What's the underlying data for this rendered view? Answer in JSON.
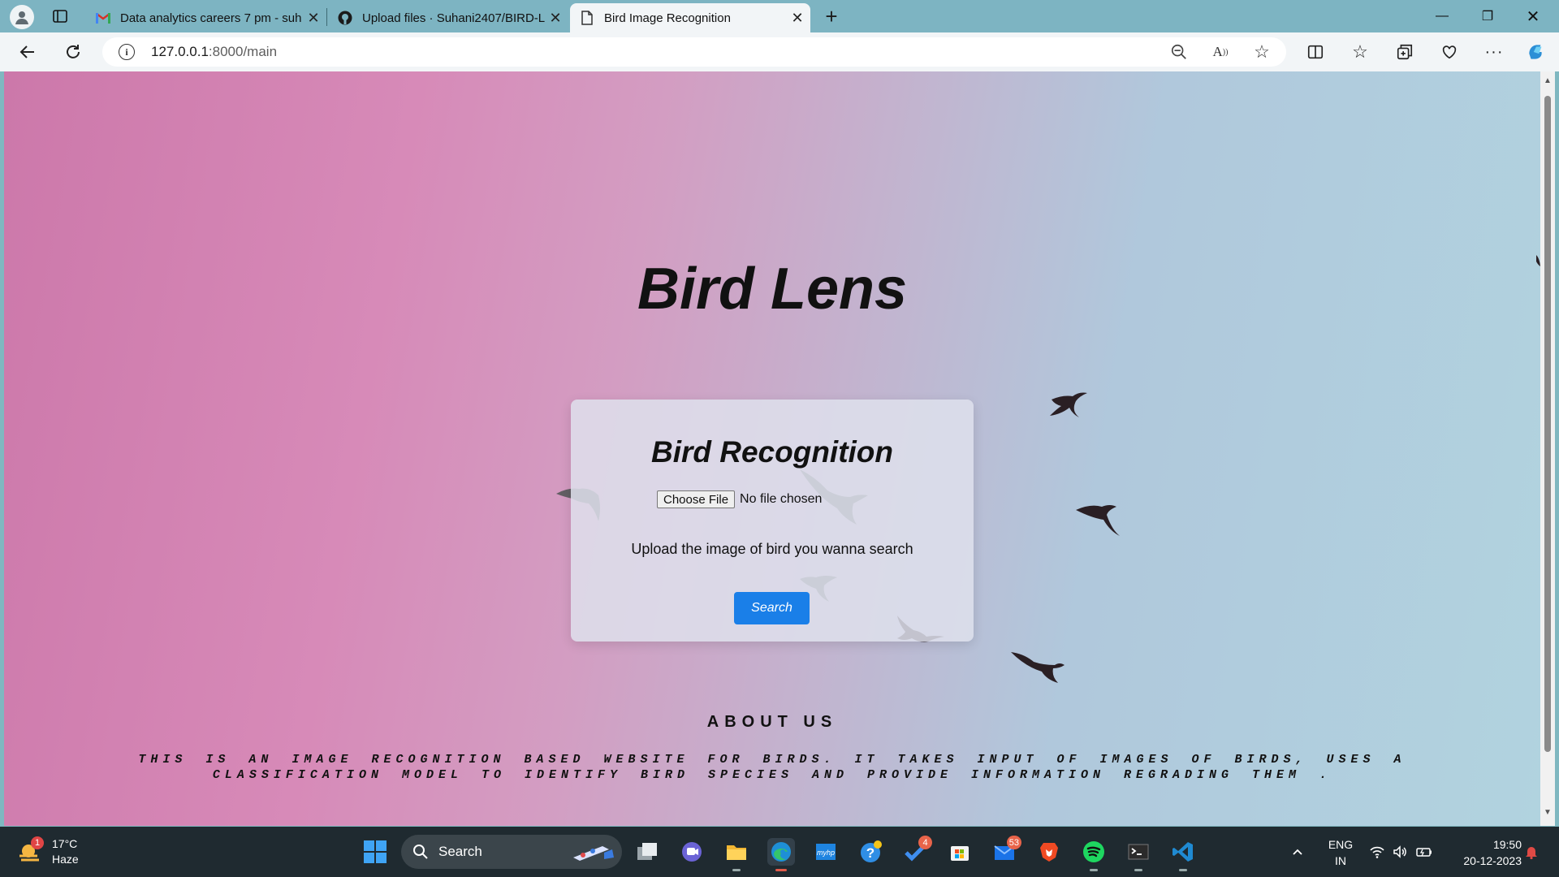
{
  "browser": {
    "tabs": [
      {
        "title": "Data analytics careers 7 pm - suh",
        "favicon": "gmail-icon"
      },
      {
        "title": "Upload files · Suhani2407/BIRD-L",
        "favicon": "github-icon"
      },
      {
        "title": "Bird Image Recognition",
        "favicon": "page-icon",
        "active": true
      }
    ],
    "url_host": "127.0.0.1",
    "url_path": ":8000/main"
  },
  "page": {
    "brand_title": "Bird Lens",
    "card": {
      "heading": "Bird Recognition",
      "file_button": "Choose File",
      "file_status": "No file chosen",
      "instruction": "Upload the image of bird you wanna search",
      "search_button": "Search"
    },
    "about": {
      "heading": "ABOUT US",
      "text": "THIS IS AN IMAGE RECOGNITION BASED WEBSITE FOR BIRDS. IT TAKES INPUT OF IMAGES OF BIRDS, USES A CLASSIFICATION MODEL TO IDENTIFY BIRD SPECIES AND PROVIDE INFORMATION REGRADING THEM ."
    }
  },
  "taskbar": {
    "weather": {
      "temp": "17°C",
      "condition": "Haze",
      "badge": "1"
    },
    "search_label": "Search",
    "badges": {
      "todo": "4",
      "mail": "53"
    },
    "language": {
      "line1": "ENG",
      "line2": "IN"
    },
    "clock": {
      "time": "19:50",
      "date": "20-12-2023"
    }
  },
  "colors": {
    "accent": "#1a7fe8",
    "titlebar": "#7db4c2",
    "taskbar": "#1f2a30"
  }
}
